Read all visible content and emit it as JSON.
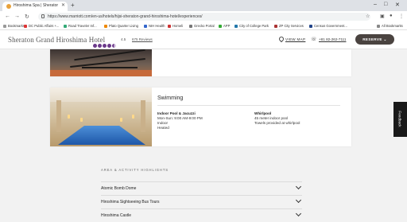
{
  "browser": {
    "tab_title": "Hiroshima Spa | Sheraton Gran",
    "url": "https://www.marriott.com/en-us/hotels/hijsi-sheraton-grand-hiroshima-hotel/experiences/",
    "bookmarks": [
      "Bookmarks",
      "DC Public Affairs +...",
      "Road Traveler Inf...",
      "Plato Quarter Living",
      "NIH Health",
      "Homeli",
      "Grecko Portal",
      "APP",
      "City of College Park",
      "ZP City Services",
      "Census Government..."
    ],
    "all_bookmarks": "All Bookmarks"
  },
  "header": {
    "brand": "Sheraton Grand Hiroshima Hotel",
    "rating": "4.5",
    "rating_value": 4.5,
    "reviews": "675 Reviews",
    "view_map": "VIEW MAP",
    "phone": "+81 82-262-7111",
    "reserve": "RESERVE"
  },
  "swimming": {
    "title": "Swimming",
    "left": {
      "heading": "Indoor Pool & Jacuzzi",
      "lines": [
        "Mon-Sun: 9:00 AM-9:00 PM",
        "Indoor",
        "Heated"
      ]
    },
    "right": {
      "heading": "Whirlpool",
      "lines": [
        "45 meter indoor pool",
        "Towels provided at whirlpool"
      ]
    }
  },
  "feedback": "Feedback",
  "highlights": {
    "label": "AREA & ACTIVITY HIGHLIGHTS",
    "items": [
      "Atomic Bomb Dome",
      "Hiroshima Sightseeing Bus Tours",
      "Hiroshima Castle"
    ]
  },
  "colors": {
    "brand_purple": "#6b3a8a",
    "reserve_bg": "#4a4340"
  }
}
